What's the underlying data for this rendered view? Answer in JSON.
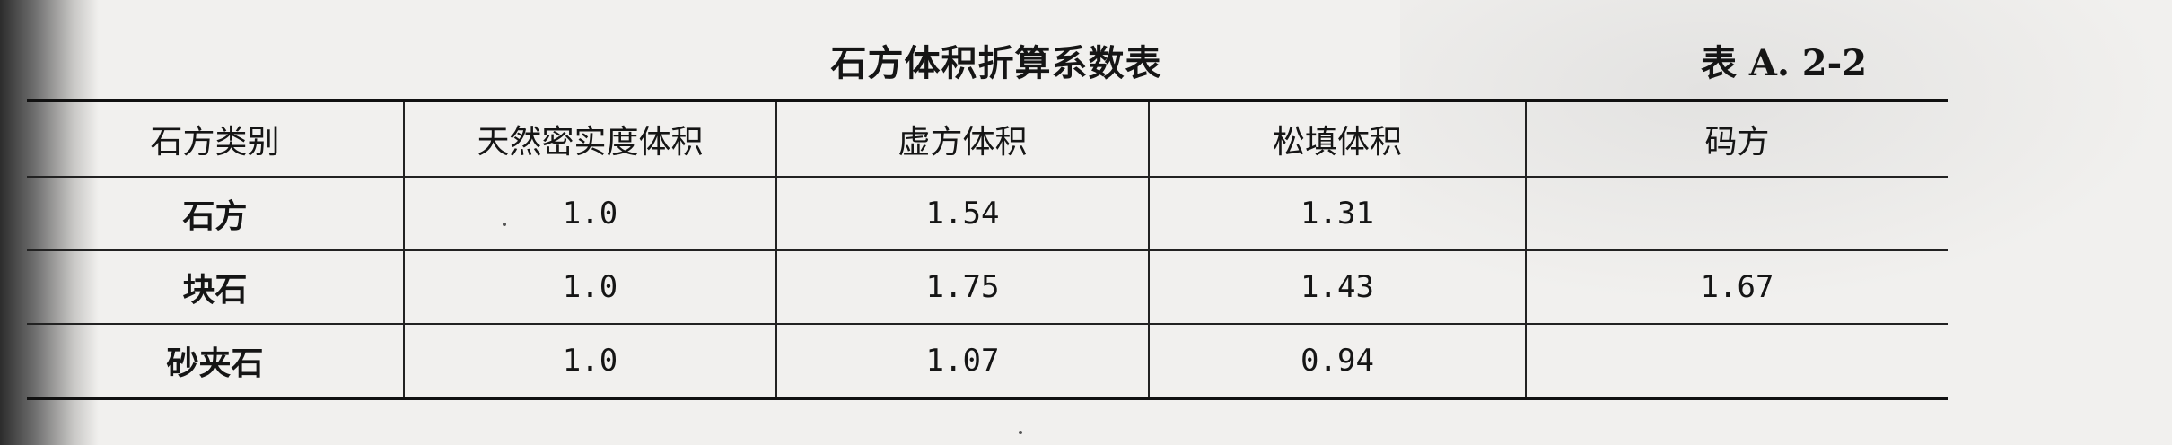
{
  "document": {
    "title": "石方体积折算系数表",
    "table_number": "表 A. 2-2"
  },
  "table": {
    "headers": [
      "石方类别",
      "天然密实度体积",
      "虚方体积",
      "松填体积",
      "码方"
    ],
    "rows": [
      [
        "石方",
        "1.0",
        "1.54",
        "1.31",
        ""
      ],
      [
        "块石",
        "1.0",
        "1.75",
        "1.43",
        "1.67"
      ],
      [
        "砂夹石",
        "1.0",
        "1.07",
        "0.94",
        ""
      ]
    ]
  }
}
